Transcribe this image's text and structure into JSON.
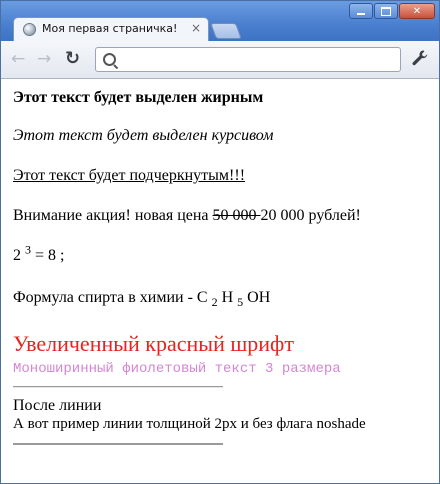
{
  "window": {
    "tab_title": "Моя первая страничка!",
    "tab_close": "×"
  },
  "toolbar": {
    "back_glyph": "←",
    "forward_glyph": "→",
    "reload_glyph": "↻",
    "wrench_glyph": "🔧",
    "address_value": ""
  },
  "content": {
    "bold_text": "Этот текст будет выделен жирным",
    "italic_text": "Этот текст будет выделен курсивом",
    "underline_text": "Этот текст будет подчеркнутым!!! ",
    "sale_prefix": "Внимание акция! новая цена ",
    "sale_old_price": "50 000 ",
    "sale_new_price": "20 000 рублей!",
    "math_base": "2 ",
    "math_exponent": "3",
    "math_rest": " = 8 ;",
    "formula_prefix": "Формула спирта в химии - C ",
    "formula_sub1": "2",
    "formula_mid": " H ",
    "formula_sub2": "5",
    "formula_end": " OH",
    "red_text": "Увеличенный красный шрифт",
    "mono_text": "Моноширинный фиолетовый текст 3 размера",
    "after_line_text": "После линии",
    "example_text": "А вот пример линии толщиной 2px и без флага noshade"
  },
  "colors": {
    "red_text": "#e8231d",
    "mono_text": "#d486d2",
    "chrome_blue": "#4a7fcf"
  }
}
